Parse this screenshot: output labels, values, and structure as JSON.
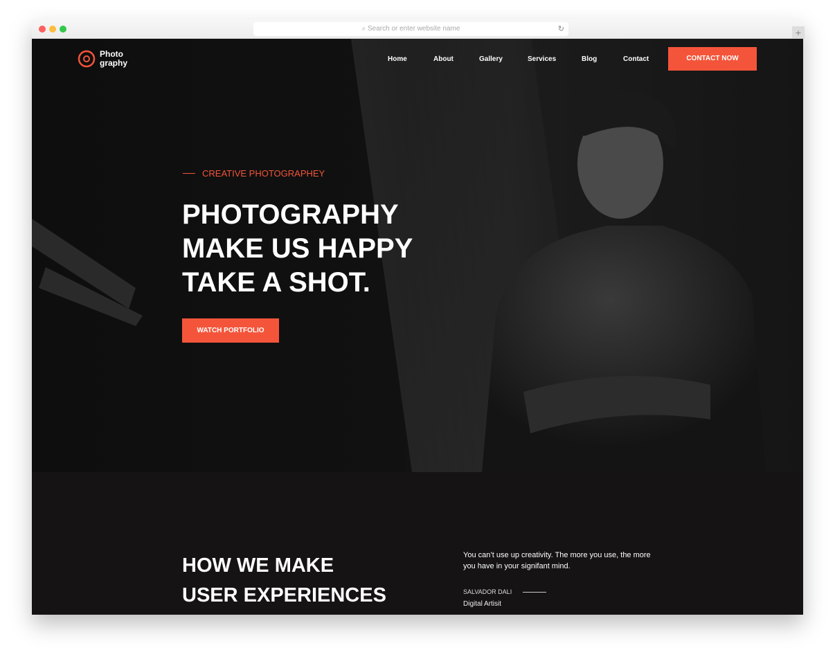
{
  "browser": {
    "url_placeholder": "Search or enter website name"
  },
  "logo": {
    "line1": "Photo",
    "line2": "graphy"
  },
  "nav": {
    "items": [
      "Home",
      "About",
      "Gallery",
      "Services",
      "Blog",
      "Contact"
    ],
    "cta": "CONTACT NOW"
  },
  "hero": {
    "eyebrow": "CREATIVE PHOTOGRAPHEY",
    "title_lines": [
      "PHOTOGRAPHY",
      "MAKE US HAPPY",
      "TAKE A SHOT."
    ],
    "button": "WATCH PORTFOLIO"
  },
  "section": {
    "title_lines": [
      "HOW WE MAKE",
      "USER EXPERIENCES"
    ],
    "quote": "You can’t use up creativity. The more you use, the more you have in your signifant mind.",
    "author": "SALVADOR DALI",
    "role": "Digital Artisit"
  },
  "colors": {
    "accent": "#f4553a",
    "background": "#111111"
  }
}
